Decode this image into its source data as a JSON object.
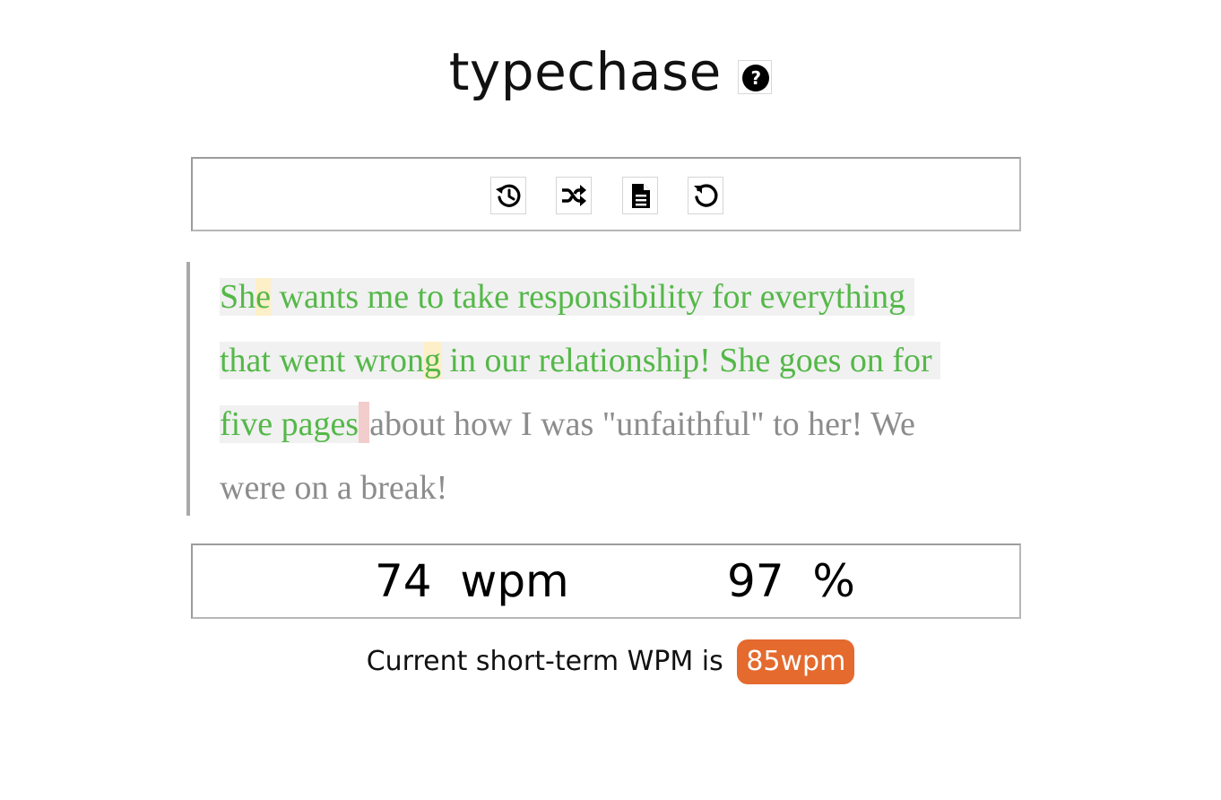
{
  "app": {
    "title": "typechase",
    "help_icon": "question-circle-icon",
    "help_glyph": "?"
  },
  "toolbar": {
    "buttons": [
      {
        "name": "history-icon",
        "label": "history"
      },
      {
        "name": "shuffle-icon",
        "label": "shuffle"
      },
      {
        "name": "document-icon",
        "label": "document"
      },
      {
        "name": "restart-icon",
        "label": "restart"
      }
    ]
  },
  "passage": {
    "lines": [
      [
        {
          "t": "Sh",
          "s": "typed"
        },
        {
          "t": "e",
          "s": "errfixed"
        },
        {
          "t": " wants me to take responsibility for everything ",
          "s": "typed"
        }
      ],
      [
        {
          "t": "that went wron",
          "s": "typed"
        },
        {
          "t": "g",
          "s": "errfixed"
        },
        {
          "t": " in our relationship! She goes on for ",
          "s": "typed"
        }
      ],
      [
        {
          "t": "five pages",
          "s": "typed"
        },
        {
          "t": "",
          "s": "cursor"
        },
        {
          "t": "about how I was \"unfaithful\" to her! We",
          "s": "rest"
        }
      ],
      [
        {
          "t": "were on a break!",
          "s": "rest"
        }
      ]
    ],
    "colors": {
      "typed": "#54b848",
      "untyped": "#8c8c8c",
      "typed_bg": "#f1f1f1",
      "corrected_bg": "#fdefc8",
      "cursor_bg": "#f3cccc"
    }
  },
  "stats": {
    "wpm_value": "74",
    "wpm_unit": "wpm",
    "accuracy_value": "97",
    "accuracy_unit": "%"
  },
  "footer": {
    "text": "Current short-term WPM is",
    "badge": "85wpm",
    "badge_color": "#e46a2e"
  }
}
